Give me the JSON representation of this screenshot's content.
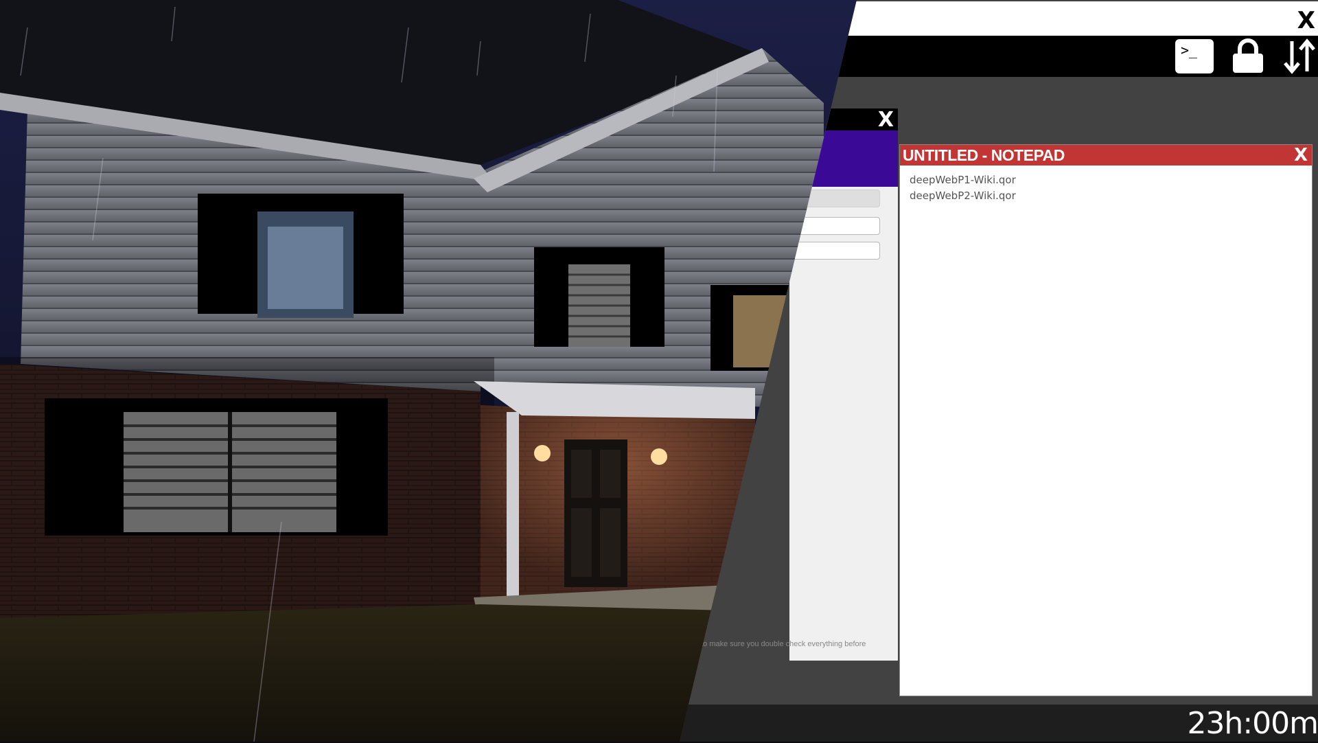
{
  "window": {
    "close_label": "X"
  },
  "taskbar": {
    "terminal_glyph": ">_",
    "icons": [
      "terminal-icon",
      "lock-icon",
      "sort-icon"
    ]
  },
  "dialog": {
    "close_label": "X",
    "header_color": "#3a0a96",
    "footer_note": "t to make sure you double check everything before"
  },
  "notepad": {
    "title": "UNTITLED - NOTEPAD",
    "close_label": "X",
    "titlebar_color": "#c23535",
    "lines": [
      "deepWebP1-Wiki.qor",
      "deepWebP2-Wiki.qor"
    ]
  },
  "clock": {
    "time": "23h:00m"
  }
}
